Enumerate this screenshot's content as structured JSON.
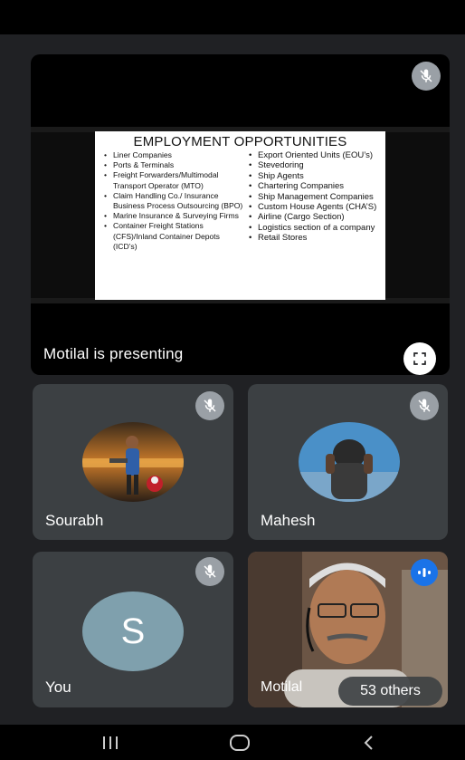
{
  "presentation": {
    "presenter_label": "Motilal is presenting",
    "slide": {
      "title": "EMPLOYMENT OPPORTUNITIES",
      "left_items": [
        "Liner Companies",
        "Ports & Terminals",
        "Freight Forwarders/Multimodal Transport Operator (MTO)",
        "Claim Handling Co./ Insurance Business Process Outsourcing (BPO)",
        "Marine Insurance & Surveying Firms",
        "Container Freight Stations (CFS)/Inland Container Depots (ICD’s)"
      ],
      "right_items": [
        "Export Oriented Units (EOU’s)",
        "Stevedoring",
        "Ship Agents",
        "Chartering Companies",
        "Ship Management Companies",
        "Custom House Agents (CHA’S)",
        "Airline (Cargo Section)",
        "Logistics section of a company",
        "Retail Stores"
      ]
    }
  },
  "participants": [
    {
      "name": "Sourabh",
      "muted": true
    },
    {
      "name": "Mahesh",
      "muted": true
    },
    {
      "name": "You",
      "initial": "S",
      "muted": true
    },
    {
      "name": "Motilal",
      "speaking": true
    }
  ],
  "others_count_label": "53 others",
  "colors": {
    "background": "#202124",
    "tile": "#3c4043",
    "mute_badge": "#9aa0a6",
    "speaking_badge": "#1a73e8",
    "letter_avatar": "#7fa0ad"
  },
  "icons": [
    "mic-off-icon",
    "fullscreen-icon",
    "speaking-icon",
    "recents-icon",
    "home-icon",
    "back-icon"
  ]
}
